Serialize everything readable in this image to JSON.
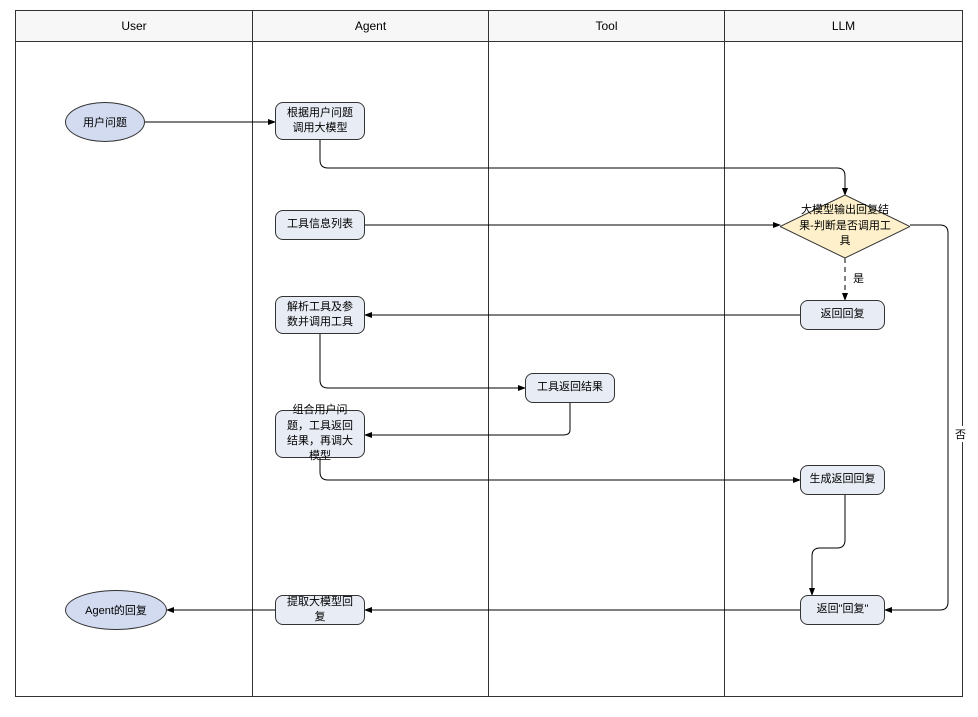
{
  "lanes": {
    "user": "User",
    "agent": "Agent",
    "tool": "Tool",
    "llm": "LLM"
  },
  "nodes": {
    "user_question": "用户问题",
    "agent_response": "Agent的回复",
    "invoke_llm": "根据用户问题调用大模型",
    "tool_info_list": "工具信息列表",
    "parse_invoke_tool": "解析工具及参数并调用工具",
    "combine_reinvoke": "组合用户问题，工具返回结果，再调大模型",
    "extract_reply": "提取大模型回复",
    "tool_result": "工具返回结果",
    "decision": "大模型输出回复结果-判断是否调用工具",
    "return_reply": "返回回复",
    "gen_reply": "生成返回回复",
    "return_reply2": "返回\"回复\""
  },
  "edges": {
    "yes": "是",
    "no": "否"
  }
}
